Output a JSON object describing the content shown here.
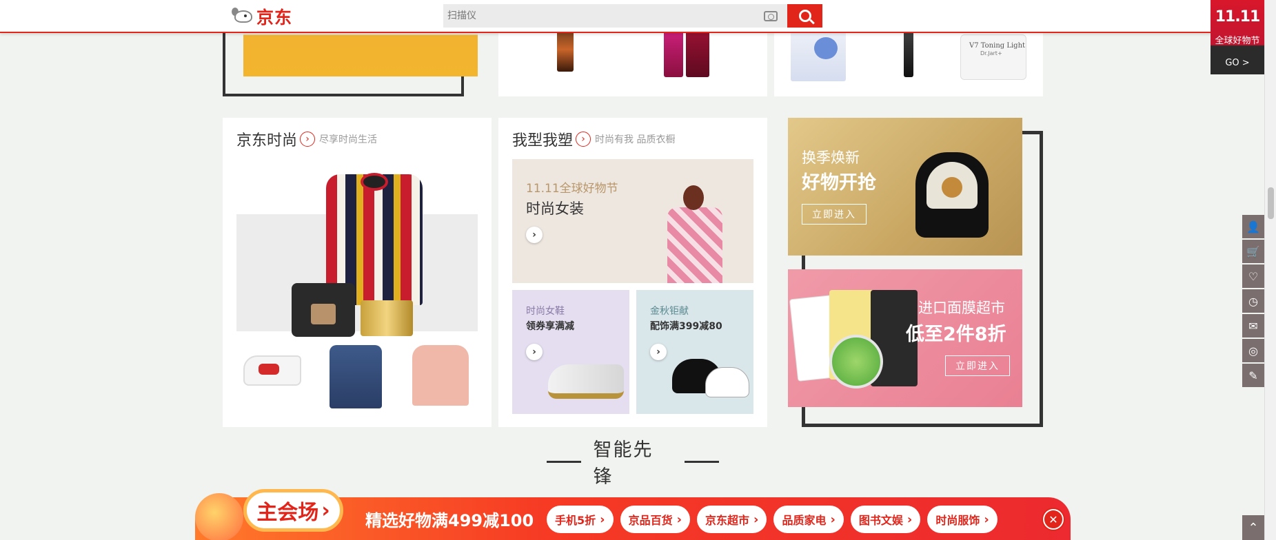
{
  "header": {
    "logo_text": "京东",
    "search_placeholder": "扫描仪"
  },
  "corner_badge": {
    "big": "11.11",
    "small": "全球好物节",
    "go": "GO >"
  },
  "top_products": {
    "mask_label": "V7 Toning Light",
    "mask_brand": "Dr.Jart+"
  },
  "cards": [
    {
      "title": "京东时尚",
      "sub": "尽享时尚生活"
    },
    {
      "title": "我型我塑",
      "sub": "时尚有我 品质衣橱"
    }
  ],
  "tiles": {
    "women": {
      "line1": "11.11全球好物节",
      "line2": "时尚女装"
    },
    "shoes": {
      "line1": "时尚女鞋",
      "line2": "领券享满减"
    },
    "accessories": {
      "line1": "金秋钜献",
      "line2": "配饰满399减80"
    }
  },
  "promos": [
    {
      "line1": "换季焕新",
      "line2": "好物开抢",
      "button": "立即进入",
      "color": "#d4b472"
    },
    {
      "line1": "进口面膜超市",
      "line2": "低至2件8折",
      "button": "立即进入",
      "color": "#ea8a9b"
    }
  ],
  "section_heading": "智能先锋",
  "promo_bar": {
    "main": "主会场",
    "slogan": "精选好物满499减100",
    "pills": [
      "手机5折",
      "京品百货",
      "京东超市",
      "品质家电",
      "图书文娱",
      "时尚服饰"
    ]
  },
  "toolbar_icons": [
    "user-icon",
    "cart-icon",
    "heart-icon",
    "history-icon",
    "message-icon",
    "service-icon",
    "feedback-icon"
  ],
  "colors": {
    "brand_red": "#e1251b"
  }
}
